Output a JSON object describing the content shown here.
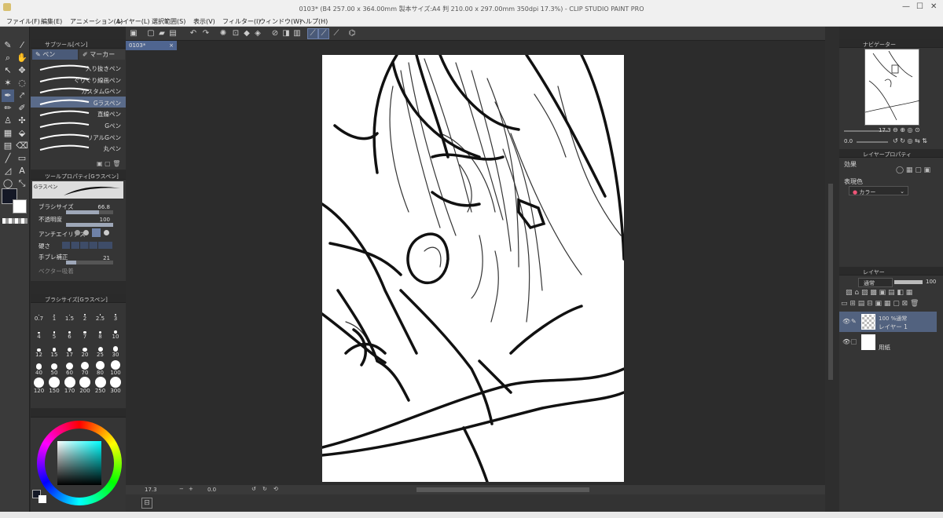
{
  "titlebar": {
    "title": "0103* (B4 257.00 x 364.00mm 製本サイズ:A4 判 210.00 x 297.00mm 350dpi 17.3%) - CLIP STUDIO PAINT PRO",
    "minimize": "—",
    "maximize": "☐",
    "close": "✕"
  },
  "menu": [
    "ファイル(F)",
    "編集(E)",
    "アニメーション(A)",
    "レイヤー(L)",
    "選択範囲(S)",
    "表示(V)",
    "フィルター(I)",
    "ウィンドウ(W)",
    "ヘルプ(H)"
  ],
  "colors": {
    "accent": "#4f6590",
    "selected": "#5a6b8a",
    "panel": "#353535"
  },
  "document": {
    "tab": "0103*"
  },
  "subtool": {
    "header": "サブツール[ペン]",
    "tabs": [
      "ペン",
      "マーカー"
    ],
    "brushes": [
      "入り抜きペン",
      "ぐりぐり線画ペン",
      "カスタムGペン",
      "Gラスペン",
      "直線ペン",
      "Gペン",
      "リアルGペン",
      "丸ペン"
    ],
    "selected_index": 3
  },
  "toolprop": {
    "header": "ツールプロパティ[Gラスペン]",
    "brush_name": "Gラスペン",
    "rows": [
      {
        "label": "ブラシサイズ",
        "value": "66.8",
        "level": 0.7
      },
      {
        "label": "不透明度",
        "value": "100",
        "level": 1.0
      },
      {
        "label": "アンチエイリアス",
        "value": ""
      },
      {
        "label": "硬さ",
        "value": ""
      },
      {
        "label": "手ブレ補正",
        "value": "21",
        "level": 0.21
      },
      {
        "label": "ベクター吸着",
        "value": ""
      }
    ]
  },
  "brushsize": {
    "header": "ブラシサイズ[Gラスペン]",
    "labels": [
      "0.7",
      "1",
      "1.5",
      "2",
      "2.5",
      "3",
      "4",
      "5",
      "6",
      "7",
      "8",
      "10",
      "12",
      "15",
      "17",
      "20",
      "25",
      "30",
      "40",
      "50",
      "60",
      "70",
      "80",
      "100",
      "120",
      "150",
      "170",
      "200",
      "250",
      "300"
    ]
  },
  "navigator": {
    "header": "ナビゲーター",
    "zoom": "17.3",
    "angle": "0.0"
  },
  "layerprop": {
    "header": "レイヤープロパティ",
    "effect_label": "効果",
    "color_label": "表現色",
    "color_value": "カラー"
  },
  "layers": {
    "header": "レイヤー",
    "blend_mode": "通常",
    "opacity": "100",
    "items": [
      {
        "meta": "100 %通常",
        "name": "レイヤー 1"
      },
      {
        "meta": "",
        "name": "用紙"
      }
    ]
  },
  "status": {
    "zoom": "17.3",
    "angle": "0.0"
  }
}
